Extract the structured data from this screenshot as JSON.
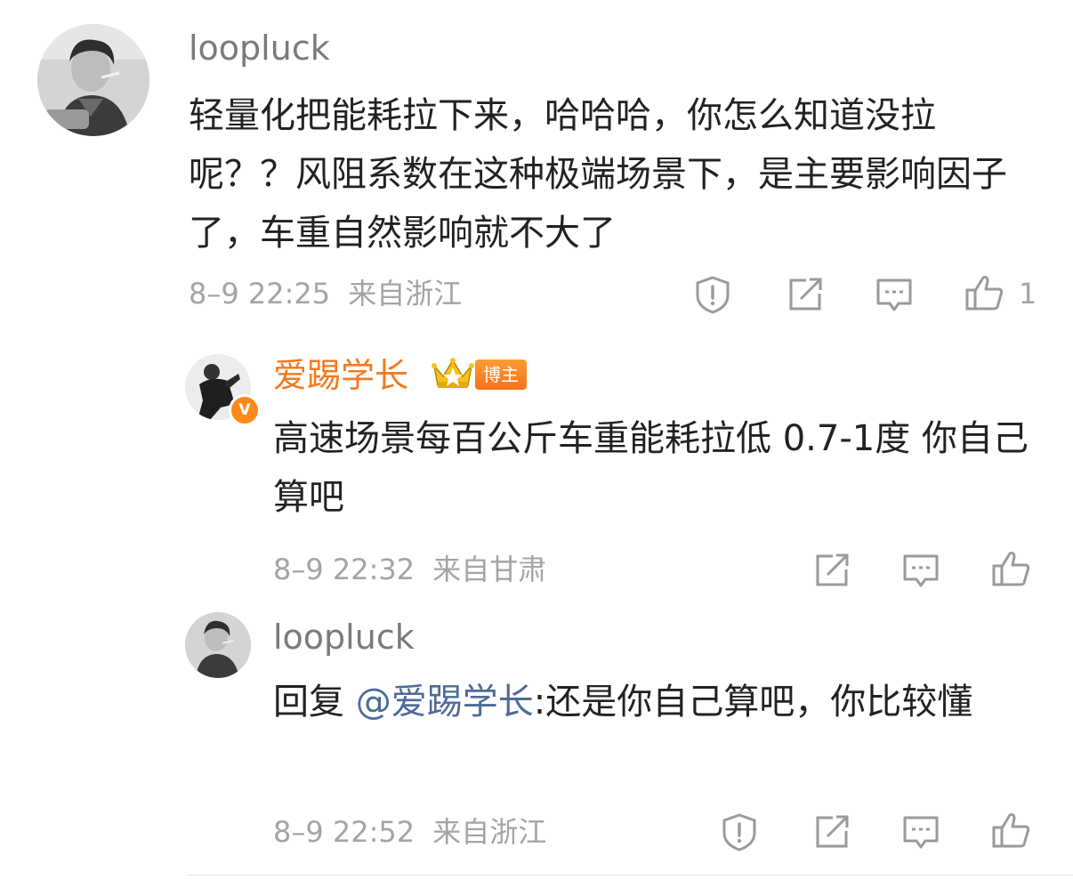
{
  "comments": [
    {
      "username": "loopluck",
      "text": "轻量化把能耗拉下来，哈哈哈，你怎么知道没拉呢？？风阻系数在这种极端场景下，是主要影响因子了，车重自然影响就不大了",
      "time": "8–9 22:25",
      "location": "来自浙江",
      "like_count": "1"
    }
  ],
  "replies": [
    {
      "username": "爱踢学长",
      "badge": "博主",
      "verified_mark": "V",
      "text": "高速场景每百公斤车重能耗拉低 0.7-1度 你自己算吧",
      "time": "8–9 22:32",
      "location": "来自甘肃"
    },
    {
      "username": "loopluck",
      "reply_prefix": "回复 ",
      "mention": "@爱踢学长",
      "text_after": ":还是你自己算吧，你比较懂",
      "time": "8–9 22:52",
      "location": "来自浙江"
    }
  ],
  "icons": {
    "report": "report-shield-icon",
    "share": "share-icon",
    "comment": "comment-bubble-icon",
    "like": "thumbs-up-icon"
  },
  "colors": {
    "username_gray": "#7a7a7a",
    "blogger_orange": "#f37a1f",
    "mention_blue": "#4d6b9a",
    "meta_gray": "#a4a4a4",
    "text": "#222222"
  }
}
